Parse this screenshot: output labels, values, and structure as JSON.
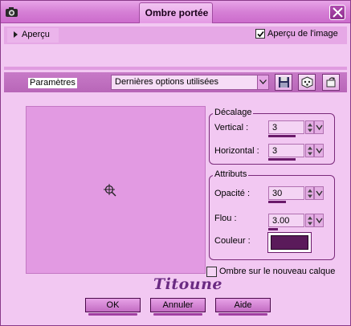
{
  "window": {
    "title": "Ombre portée",
    "icon": "camera-icon",
    "close_icon": "close-x-icon"
  },
  "preview_bar": {
    "apercu_label": "Aperçu",
    "image_preview_label": "Aperçu de l'image",
    "image_preview_checked": true
  },
  "presets": {
    "label": "Paramètres",
    "selected": "Dernières options utilisées",
    "tools": [
      "save-preset-icon",
      "randomize-dice-icon",
      "reset-icon"
    ]
  },
  "offset": {
    "title": "Décalage",
    "vertical_label": "Vertical :",
    "vertical_value": "3",
    "horizontal_label": "Horizontal :",
    "horizontal_value": "3"
  },
  "attributes": {
    "title": "Attributs",
    "opacity_label": "Opacité :",
    "opacity_value": "30",
    "blur_label": "Flou :",
    "blur_value": "3.00",
    "color_label": "Couleur :",
    "color_value": "#5a1a5a"
  },
  "new_layer": {
    "label": "Ombre sur le nouveau calque",
    "checked": false
  },
  "watermark": "Titoune",
  "buttons": {
    "ok": "OK",
    "cancel": "Annuler",
    "help": "Aide"
  },
  "colors": {
    "frame": "#c060c0",
    "panel": "#f2c8f2",
    "preview_area": "#e29ae2",
    "accent_dark": "#6a1a6a"
  }
}
